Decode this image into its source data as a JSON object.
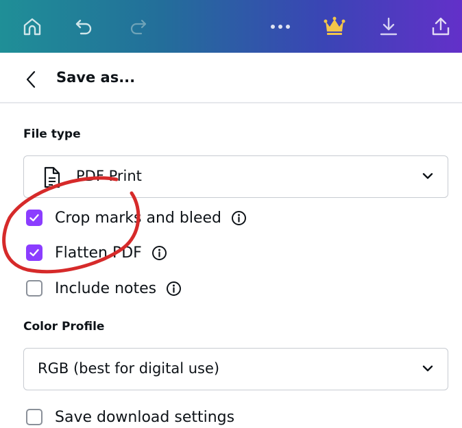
{
  "toolbar": {
    "icons": [
      "home-icon",
      "undo-icon",
      "redo-icon",
      "more-icon",
      "crown-icon",
      "download-icon",
      "share-icon"
    ]
  },
  "header": {
    "title": "Save as..."
  },
  "file_type": {
    "label": "File type",
    "selected": "PDF Print",
    "icon": "document-icon"
  },
  "options": [
    {
      "label": "Crop marks and bleed",
      "checked": true,
      "info": true
    },
    {
      "label": "Flatten PDF",
      "checked": true,
      "info": true
    },
    {
      "label": "Include notes",
      "checked": false,
      "info": true
    }
  ],
  "color_profile": {
    "label": "Color Profile",
    "selected": "RGB (best for digital use)"
  },
  "save_settings": {
    "label": "Save download settings",
    "checked": false
  },
  "colors": {
    "accent": "#8b3dff",
    "annotation": "#d62a2a",
    "gradient_start": "#1f8f97",
    "gradient_end": "#6330c9"
  }
}
